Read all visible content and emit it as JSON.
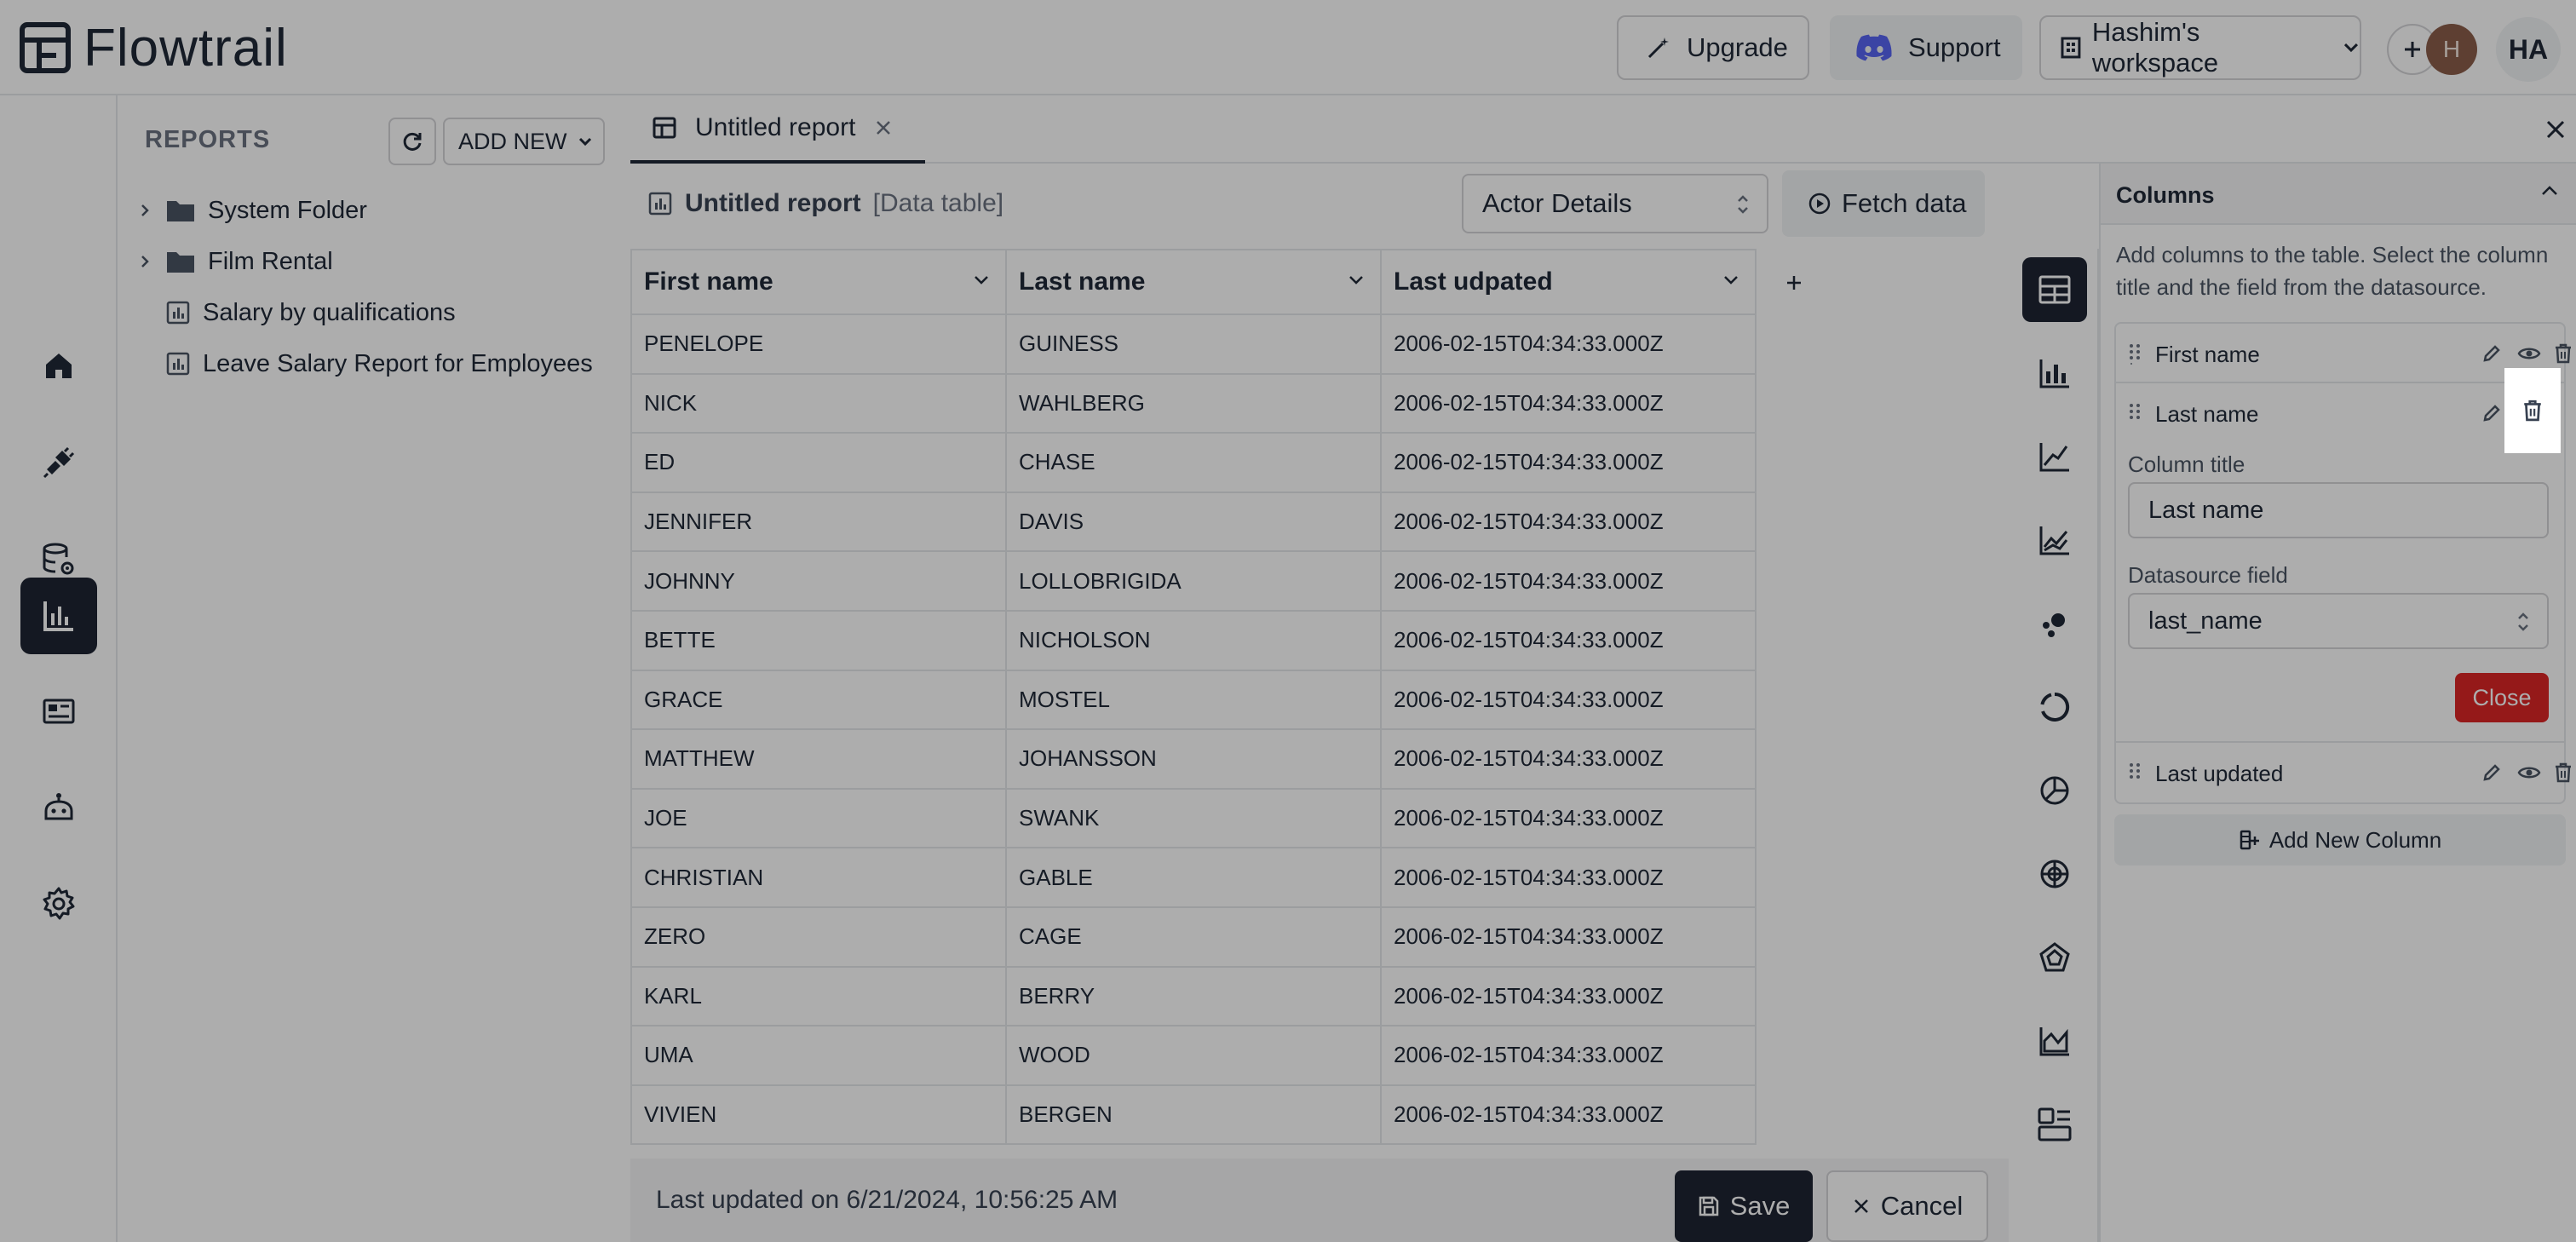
{
  "app": {
    "name": "Flowtrail"
  },
  "topbar": {
    "upgrade_label": "Upgrade",
    "support_label": "Support",
    "workspace_label": "Hashim's workspace",
    "avatar_initial": "H",
    "user_initials": "HA"
  },
  "rail": {
    "items": [
      "home-icon",
      "plug-icon",
      "database-settings-icon",
      "reports-chart-icon",
      "dashboard-icon",
      "bot-icon",
      "gear-icon"
    ],
    "active": "reports-chart-icon"
  },
  "reports_panel": {
    "title": "REPORTS",
    "add_new_label": "ADD NEW",
    "items": [
      {
        "label": "System Folder",
        "type": "folder"
      },
      {
        "label": "Film Rental",
        "type": "folder"
      },
      {
        "label": "Salary by qualifications",
        "type": "report"
      },
      {
        "label": "Leave Salary Report for Employees",
        "type": "report"
      }
    ]
  },
  "tab": {
    "label": "Untitled report"
  },
  "report": {
    "name": "Untitled report",
    "type_label": "[Data table]",
    "datasource": "Actor Details",
    "fetch_label": "Fetch data"
  },
  "table": {
    "headers": [
      "First name",
      "Last name",
      "Last udpated"
    ],
    "rows": [
      [
        "PENELOPE",
        "GUINESS",
        "2006-02-15T04:34:33.000Z"
      ],
      [
        "NICK",
        "WAHLBERG",
        "2006-02-15T04:34:33.000Z"
      ],
      [
        "ED",
        "CHASE",
        "2006-02-15T04:34:33.000Z"
      ],
      [
        "JENNIFER",
        "DAVIS",
        "2006-02-15T04:34:33.000Z"
      ],
      [
        "JOHNNY",
        "LOLLOBRIGIDA",
        "2006-02-15T04:34:33.000Z"
      ],
      [
        "BETTE",
        "NICHOLSON",
        "2006-02-15T04:34:33.000Z"
      ],
      [
        "GRACE",
        "MOSTEL",
        "2006-02-15T04:34:33.000Z"
      ],
      [
        "MATTHEW",
        "JOHANSSON",
        "2006-02-15T04:34:33.000Z"
      ],
      [
        "JOE",
        "SWANK",
        "2006-02-15T04:34:33.000Z"
      ],
      [
        "CHRISTIAN",
        "GABLE",
        "2006-02-15T04:34:33.000Z"
      ],
      [
        "ZERO",
        "CAGE",
        "2006-02-15T04:34:33.000Z"
      ],
      [
        "KARL",
        "BERRY",
        "2006-02-15T04:34:33.000Z"
      ],
      [
        "UMA",
        "WOOD",
        "2006-02-15T04:34:33.000Z"
      ],
      [
        "VIVIEN",
        "BERGEN",
        "2006-02-15T04:34:33.000Z"
      ]
    ]
  },
  "chart_types": [
    "table-icon",
    "bar-chart-icon",
    "line-chart-icon",
    "multi-line-chart-icon",
    "scatter-icon",
    "donut-icon",
    "pie-icon",
    "radar-globe-icon",
    "pentagon-icon",
    "area-chart-icon",
    "dashboard-layout-icon"
  ],
  "footer": {
    "last_updated": "Last updated on 6/21/2024, 10:56:25 AM",
    "save_label": "Save",
    "cancel_label": "Cancel"
  },
  "columns_panel": {
    "title": "Columns",
    "description": "Add columns to the table. Select the column title and the field from the datasource.",
    "columns": [
      {
        "label": "First name"
      },
      {
        "label": "Last name"
      },
      {
        "label": "Last updated"
      }
    ],
    "editor": {
      "column_title_label": "Column title",
      "column_title_value": "Last name",
      "datasource_field_label": "Datasource field",
      "datasource_field_value": "last_name",
      "close_label": "Close"
    },
    "add_column_label": "Add New Column"
  },
  "colors": {
    "accent_dark": "#1e2433",
    "danger": "#dc2626",
    "discord": "#5865F2"
  }
}
